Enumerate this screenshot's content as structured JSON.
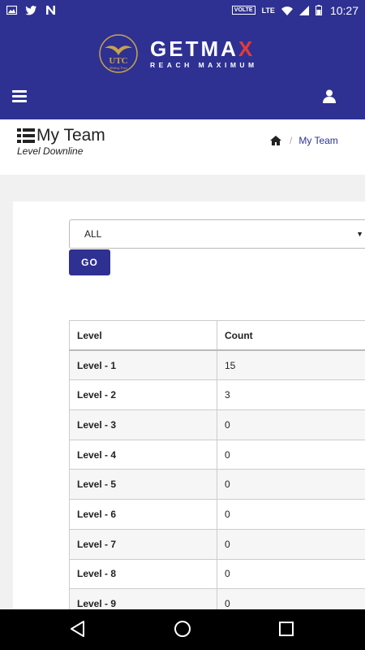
{
  "status_bar": {
    "time": "10:27",
    "volte": "VOLTE",
    "network": "LTE",
    "left_icons": [
      "image-icon",
      "twitter-icon",
      "n-app-icon"
    ],
    "right_icons": [
      "wifi-icon",
      "signal-icon",
      "battery-icon"
    ]
  },
  "header": {
    "brand_name_main": "GETMA",
    "brand_name_x": "X",
    "brand_tagline": "REACH MAXIMUM",
    "emblem_text": "UTC",
    "emblem_caption": "Making Trust",
    "accent_color": "#2e3192",
    "brand_x_color": "#e23b3b"
  },
  "page": {
    "title": "My Team",
    "subtitle": "Level Downline",
    "breadcrumb": {
      "home_icon": "home-icon",
      "current": "My Team"
    }
  },
  "filter": {
    "selected": "ALL",
    "go_label": "GO"
  },
  "table": {
    "headers": [
      "Level",
      "Count"
    ],
    "rows": [
      {
        "level": "Level - 1",
        "count": "15"
      },
      {
        "level": "Level - 2",
        "count": "3"
      },
      {
        "level": "Level - 3",
        "count": "0"
      },
      {
        "level": "Level - 4",
        "count": "0"
      },
      {
        "level": "Level - 5",
        "count": "0"
      },
      {
        "level": "Level - 6",
        "count": "0"
      },
      {
        "level": "Level - 7",
        "count": "0"
      },
      {
        "level": "Level - 8",
        "count": "0"
      },
      {
        "level": "Level - 9",
        "count": "0"
      }
    ]
  },
  "nav_bar": {
    "buttons": [
      "back-icon",
      "home-circle-icon",
      "recents-icon"
    ]
  }
}
